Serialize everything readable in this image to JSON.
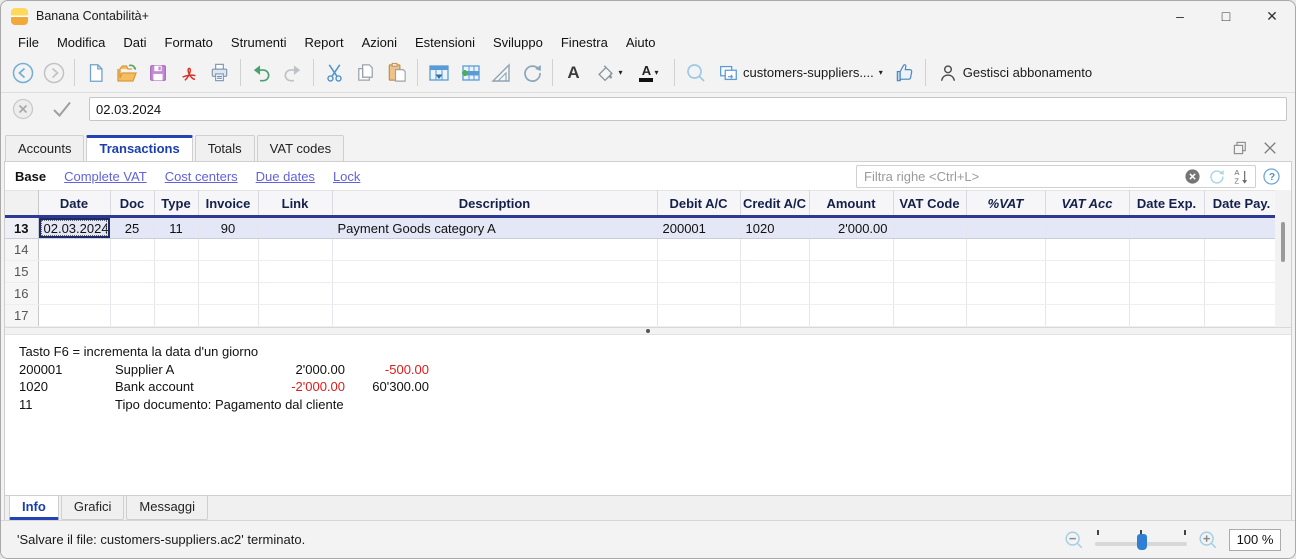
{
  "window": {
    "title": "Banana Contabilità+"
  },
  "menu": {
    "items": [
      "File",
      "Modifica",
      "Dati",
      "Formato",
      "Strumenti",
      "Report",
      "Azioni",
      "Estensioni",
      "Sviluppo",
      "Finestra",
      "Aiuto"
    ]
  },
  "toolbar": {
    "document_selector": "customers-suppliers....",
    "subscription_label": "Gestisci abbonamento"
  },
  "edit_bar": {
    "value": "02.03.2024"
  },
  "tabs": {
    "items": [
      "Accounts",
      "Transactions",
      "Totals",
      "VAT codes"
    ],
    "active": "Transactions"
  },
  "view_bar": {
    "views": [
      "Base",
      "Complete VAT",
      "Cost centers",
      "Due dates",
      "Lock"
    ],
    "active": "Base",
    "filter_placeholder": "Filtra righe <Ctrl+L>"
  },
  "table": {
    "columns": [
      "Date",
      "Doc",
      "Type",
      "Invoice",
      "Link",
      "Description",
      "Debit A/C",
      "Credit A/C",
      "Amount",
      "VAT Code",
      "%VAT",
      "VAT Acc",
      "Date Exp.",
      "Date Pay."
    ],
    "rows": [
      {
        "num": "13",
        "date": "02.03.2024",
        "doc": "25",
        "type": "11",
        "invoice": "90",
        "link": "",
        "description": "Payment Goods category A",
        "debit": "200001",
        "credit": "1020",
        "amount": "2'000.00",
        "vat_code": "",
        "pct_vat": "",
        "vat_acc": "",
        "date_exp": "",
        "date_pay": ""
      },
      {
        "num": "14"
      },
      {
        "num": "15"
      },
      {
        "num": "16"
      },
      {
        "num": "17"
      }
    ]
  },
  "info_panel": {
    "hint": "Tasto F6 = incrementa la data d'un giorno",
    "lines": [
      {
        "account": "200001",
        "name": "Supplier A",
        "amount1": "2'000.00",
        "amount2": "-500.00"
      },
      {
        "account": "1020",
        "name": "Bank account",
        "amount1": "-2'000.00",
        "amount2": "60'300.00"
      },
      {
        "account": "11",
        "name": "Tipo documento: Pagamento dal cliente",
        "amount1": "",
        "amount2": ""
      }
    ]
  },
  "bottom_tabs": {
    "items": [
      "Info",
      "Grafici",
      "Messaggi"
    ],
    "active": "Info"
  },
  "status_bar": {
    "message": "'Salvare il file: customers-suppliers.ac2' terminato.",
    "zoom_value": "100 %"
  },
  "colors": {
    "accent": "#2343b5",
    "link": "#6262e0",
    "negative": "#e01b1b",
    "selected_row": "#e4e7f5",
    "header_border": "#2c3a94"
  }
}
